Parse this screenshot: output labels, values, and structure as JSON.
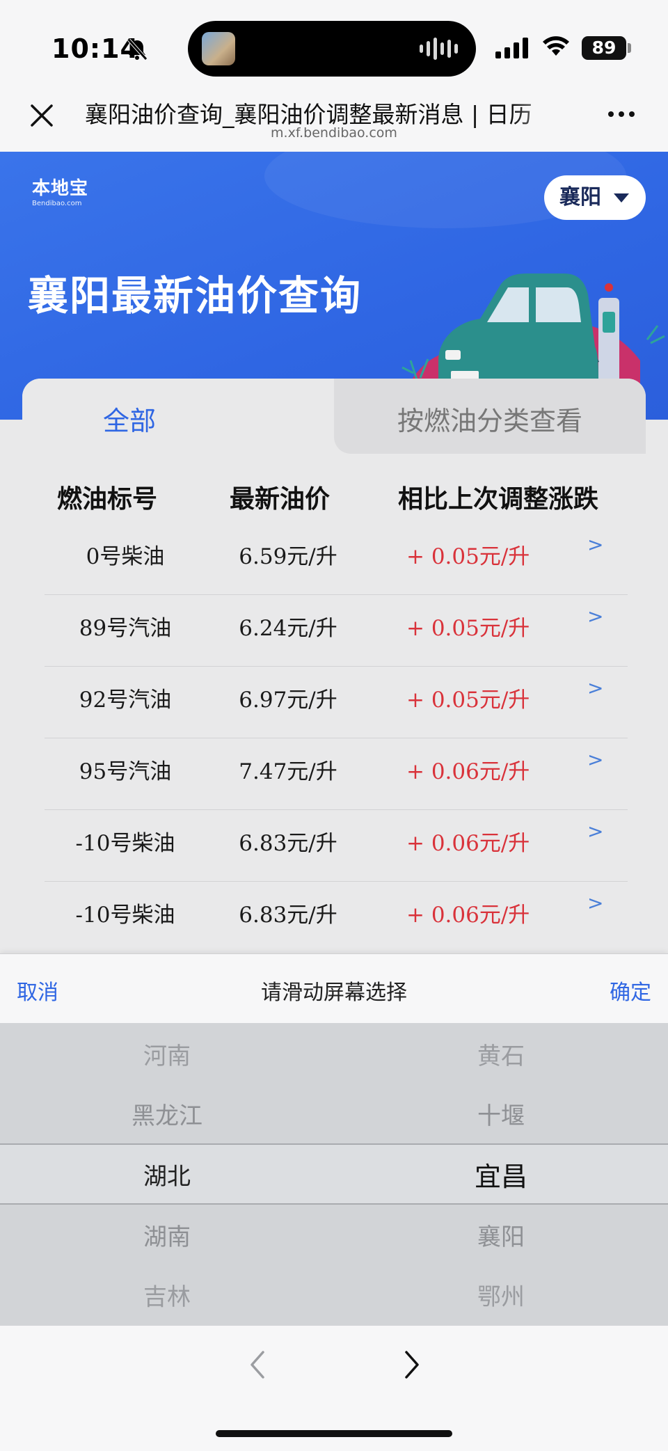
{
  "status_bar": {
    "time": "10:14",
    "battery": "89",
    "icons": [
      "bell-slash-icon",
      "cellular-signal-icon",
      "wifi-icon",
      "battery-icon"
    ]
  },
  "browser": {
    "title": "襄阳油价查询_襄阳油价调整最新消息 | 日历",
    "url": "m.xf.bendibao.com"
  },
  "banner": {
    "logo_main": "本地宝",
    "logo_sub": "Bendibao.com",
    "city": "襄阳",
    "title": "襄阳最新油价查询"
  },
  "tabs": [
    {
      "label": "全部",
      "active": true
    },
    {
      "label": "按燃油分类查看",
      "active": false
    }
  ],
  "table": {
    "headers": [
      "燃油标号",
      "最新油价",
      "相比上次调整涨跌"
    ],
    "rows": [
      {
        "grade": "0号柴油",
        "price": "6.59元/升",
        "change": "+ 0.05元/升",
        "arrow": ">"
      },
      {
        "grade": "89号汽油",
        "price": "6.24元/升",
        "change": "+ 0.05元/升",
        "arrow": ">"
      },
      {
        "grade": "92号汽油",
        "price": "6.97元/升",
        "change": "+ 0.05元/升",
        "arrow": ">"
      },
      {
        "grade": "95号汽油",
        "price": "7.47元/升",
        "change": "+ 0.06元/升",
        "arrow": ">"
      },
      {
        "grade": "-10号柴油",
        "price": "6.83元/升",
        "change": "+ 0.06元/升",
        "arrow": ">"
      },
      {
        "grade": "-10号柴油",
        "price": "6.83元/升",
        "change": "+ 0.06元/升",
        "arrow": ">"
      }
    ]
  },
  "picker": {
    "cancel": "取消",
    "hint": "请滑动屏幕选择",
    "confirm": "确定",
    "provinces": [
      "河南",
      "黑龙江",
      "湖北",
      "湖南",
      "吉林"
    ],
    "cities": [
      "黄石",
      "十堰",
      "宜昌",
      "襄阳",
      "鄂州"
    ],
    "selected_province": "湖北",
    "selected_city": "宜昌"
  },
  "colors": {
    "accent": "#2f66e3",
    "increase": "#d9323a",
    "banner": "#3a74ea"
  }
}
